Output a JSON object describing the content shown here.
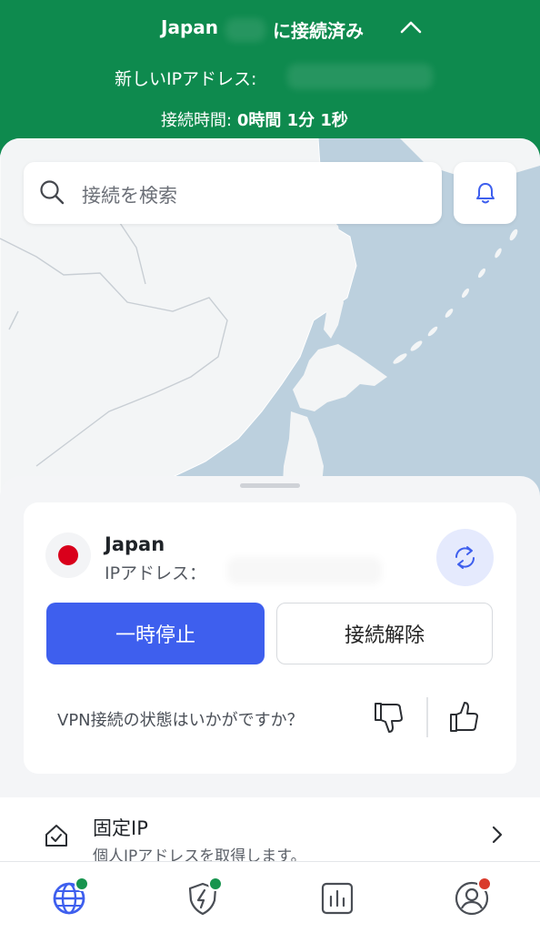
{
  "header": {
    "country": "Japan",
    "status": "に接続済み",
    "new_ip_label": "新しいIPアドレス:",
    "connection_time_label": "接続時間:",
    "connection_time_value": "0時間 1分 1秒"
  },
  "search": {
    "placeholder": "接続を検索"
  },
  "connection_card": {
    "country": "Japan",
    "ip_label": "IPアドレス：",
    "pause_label": "一時停止",
    "disconnect_label": "接続解除",
    "feedback_question": "VPN接続の状態はいかがですか？"
  },
  "dedicated_ip": {
    "title": "固定IP",
    "subtitle": "個人IPアドレスを取得します。"
  },
  "colors": {
    "header_green": "#0e8a4e",
    "accent_blue": "#3e5fee",
    "map_sea": "#bcd0de",
    "map_land": "#f3f5f6",
    "badge_green": "#17944e",
    "badge_red": "#d93a2b"
  },
  "icons": {
    "search": "search-icon",
    "bell": "bell-icon",
    "refresh": "refresh-icon",
    "thumb_down": "thumb-down-icon",
    "thumb_up": "thumb-up-icon",
    "dedicated_ip": "home-shield-icon",
    "chevron_right": "chevron-right-icon",
    "tab_globe": "globe-icon",
    "tab_shield": "shield-lightning-icon",
    "tab_stats": "bar-chart-icon",
    "tab_profile": "profile-icon"
  }
}
